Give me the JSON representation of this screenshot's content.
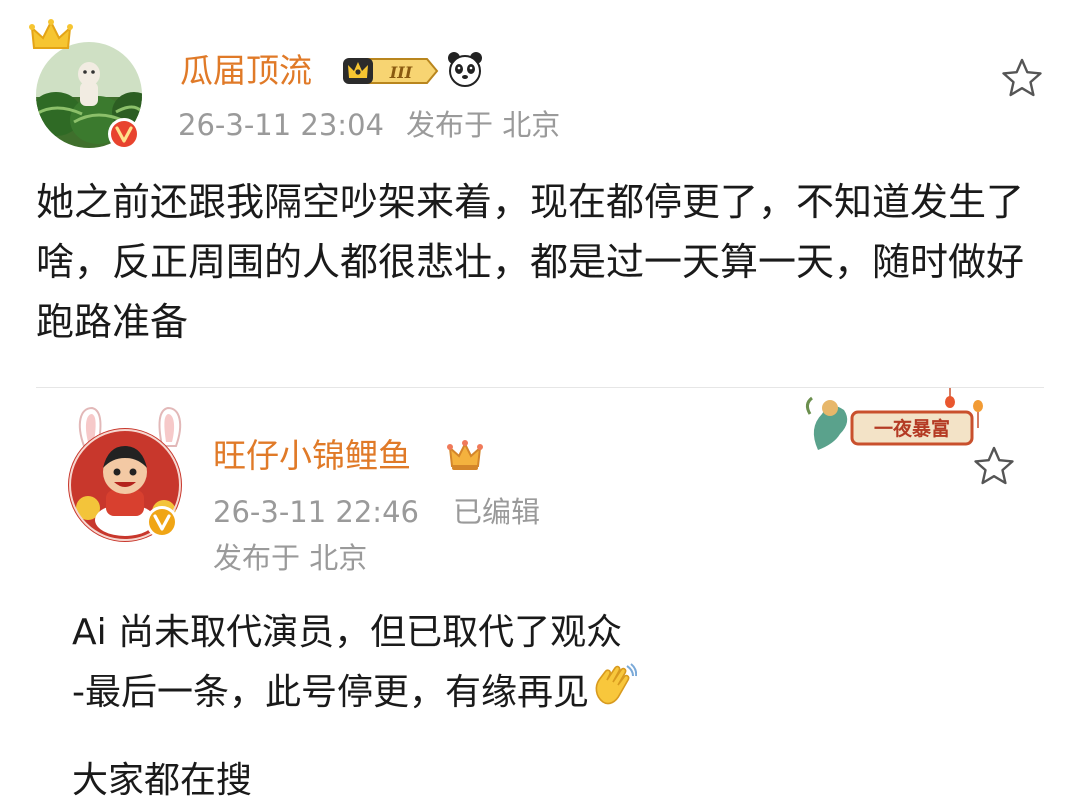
{
  "post1": {
    "username": "瓜届顶流",
    "member_level": "III",
    "time": "26-3-11 23:04",
    "location": "发布于 北京",
    "content": "她之前还跟我隔空吵架来着，现在都停更了，不知道发生了啥，反正周围的人都很悲壮，都是过一天算一天，随时做好跑路准备",
    "icons": [
      "crown-icon",
      "member-badge-icon",
      "panda-icon",
      "verified-icon",
      "star-icon"
    ]
  },
  "post2": {
    "username": "旺仔小锦鲤鱼",
    "time": "26-3-11 22:46",
    "edited_label": "已编辑",
    "location": "发布于 北京",
    "decoration_label": "一夜暴富",
    "content_line1": "Ai 尚未取代演员，但已取代了观众",
    "content_line2": "-最后一条，此号停更，有缘再见",
    "cut_text": "大家都在搜",
    "icons": [
      "rabbit-ears-icon",
      "crown-icon",
      "verified-icon",
      "waving-hand-icon",
      "star-icon"
    ]
  },
  "colors": {
    "username": "#e07a28",
    "meta": "#9a9a9a",
    "text": "#1a1a1a",
    "verified": "#f0a515",
    "divider": "#e6e6e6"
  }
}
